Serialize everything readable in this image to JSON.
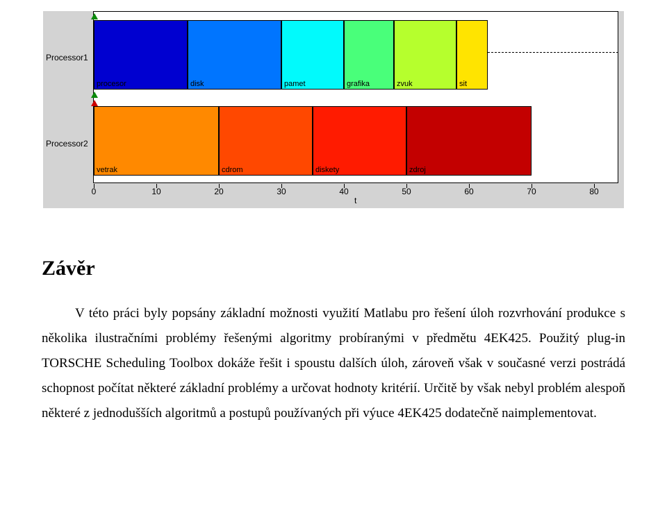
{
  "chart_data": {
    "type": "bar",
    "xlabel": "t",
    "xlim": [
      0,
      84
    ],
    "xticks": [
      0,
      10,
      20,
      30,
      40,
      50,
      60,
      70,
      80
    ],
    "rows": [
      {
        "name": "Processor1",
        "bars": [
          {
            "label": "procesor",
            "start": 0,
            "end": 15,
            "color": "#0000d0"
          },
          {
            "label": "disk",
            "start": 15,
            "end": 30,
            "color": "#0075ff"
          },
          {
            "label": "pamet",
            "start": 30,
            "end": 40,
            "color": "#01fafc"
          },
          {
            "label": "grafika",
            "start": 40,
            "end": 48,
            "color": "#49ff7a"
          },
          {
            "label": "zvuk",
            "start": 48,
            "end": 58,
            "color": "#b6ff2d"
          },
          {
            "label": "sit",
            "start": 58,
            "end": 63,
            "color": "#ffe400"
          }
        ],
        "deadline_dash": true
      },
      {
        "name": "Processor2",
        "bars": [
          {
            "label": "vetrak",
            "start": 0,
            "end": 20,
            "color": "#ff8900"
          },
          {
            "label": "cdrom",
            "start": 20,
            "end": 35,
            "color": "#ff4800"
          },
          {
            "label": "diskety",
            "start": 35,
            "end": 50,
            "color": "#ff1b00"
          },
          {
            "label": "zdroj",
            "start": 50,
            "end": 70,
            "color": "#c30000"
          }
        ]
      }
    ]
  },
  "document": {
    "heading": "Závěr",
    "paragraph": "V této práci byly popsány základní možnosti využití Matlabu pro řešení úloh rozvrhování produkce s několika ilustračními problémy řešenými algoritmy probíranými v předmětu 4EK425. Použitý plug-in TORSCHE Scheduling Toolbox  dokáže řešit i spoustu dalších úloh, zároveň však v současné verzi postrádá schopnost počítat některé základní problémy a určovat hodnoty kritérií. Určitě by však nebyl problém alespoň některé z jednodušších algoritmů a postupů používaných při výuce 4EK425 dodatečně naimplementovat."
  }
}
